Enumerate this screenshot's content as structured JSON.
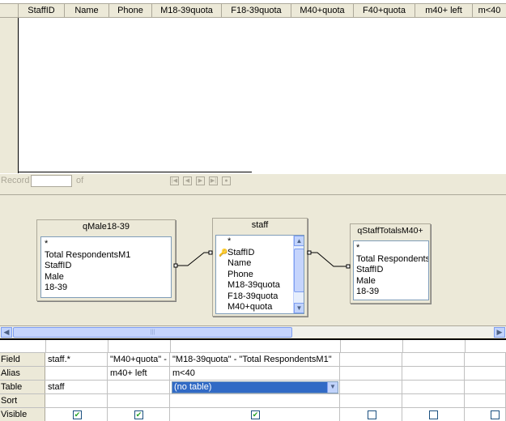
{
  "result_grid": {
    "columns": [
      "StaffID",
      "Name",
      "Phone",
      "M18-39quota",
      "F18-39quota",
      "M40+quota",
      "F40+quota",
      "m40+ left",
      "m<40"
    ]
  },
  "nav": {
    "record_label": "Record",
    "record_value": "",
    "of_label": "of"
  },
  "design": {
    "tables": [
      {
        "title": "qMale18-39",
        "fields": [
          "*",
          "Total RespondentsM1",
          "StaffID",
          "Male",
          "18-39"
        ]
      },
      {
        "title": "staff",
        "fields": [
          "*",
          "StaffID",
          "Name",
          "Phone",
          "M18-39quota",
          "F18-39quota",
          "M40+quota"
        ],
        "key_field": "StaffID"
      },
      {
        "title": "qStaffTotalsM40+",
        "fields": [
          "*",
          "Total Respondents",
          "StaffID",
          "Male",
          "18-39"
        ]
      }
    ]
  },
  "criteria": {
    "row_labels": {
      "field": "Field",
      "alias": "Alias",
      "table": "Table",
      "sort": "Sort",
      "visible": "Visible"
    },
    "columns": [
      {
        "field": "staff.*",
        "alias": "",
        "table": "staff",
        "sort": "",
        "visible": true
      },
      {
        "field": "\"M40+quota\" -",
        "alias": "m40+ left",
        "table": "",
        "sort": "",
        "visible": true
      },
      {
        "field": "\"M18-39quota\" - \"Total RespondentsM1\"",
        "alias": "m<40",
        "table": "(no table)",
        "sort": "",
        "visible": true
      },
      {
        "field": "",
        "alias": "",
        "table": "",
        "sort": "",
        "visible": false
      },
      {
        "field": "",
        "alias": "",
        "table": "",
        "sort": "",
        "visible": false
      },
      {
        "field": "",
        "alias": "",
        "table": "",
        "sort": "",
        "visible": false
      }
    ]
  }
}
